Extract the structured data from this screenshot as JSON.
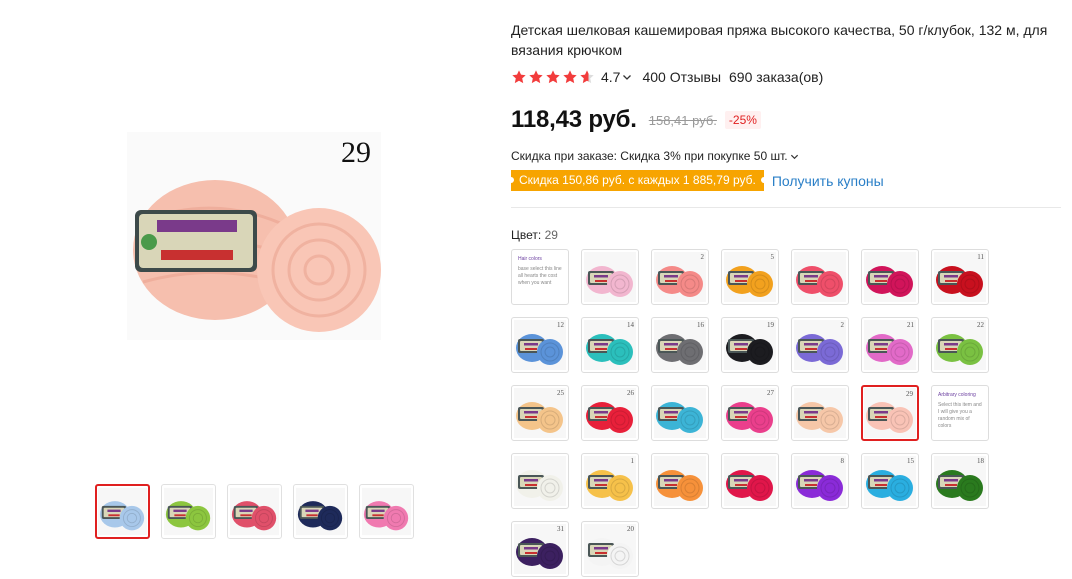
{
  "product": {
    "title": "Детская шелковая кашемировая пряжа высокого качества, 50 г/клубок, 132 м, для вязания крючком",
    "rating": "4.7",
    "reviews": "400 Отзывы",
    "orders": "690 заказа(ов)",
    "price": "118,43 руб.",
    "old_price": "158,41 руб.",
    "discount": "-25%",
    "order_discount": "Скидка при заказе: Скидка 3% при покупке 50 шт.",
    "coupon_badge": "Скидка 150,86 руб. с каждых 1 885,79 руб.",
    "coupon_link": "Получить купоны",
    "color_label": "Цвет:",
    "color_value": "29"
  },
  "gallery": {
    "main_number": "29",
    "thumbnails": [
      {
        "color": "#a8c8ea",
        "alt": "blue-yarn"
      },
      {
        "color": "#8cc63f",
        "alt": "green-yarn"
      },
      {
        "color": "#e0506a",
        "alt": "pink-red-yarn"
      },
      {
        "color": "#1e2a5a",
        "alt": "navy-yarn"
      },
      {
        "color": "#f07ab0",
        "alt": "pink-yarn"
      }
    ]
  },
  "swatches": [
    {
      "type": "text",
      "title": "Hair colors",
      "text": "base select this line all hearts the cost when you want"
    },
    {
      "type": "yarn",
      "color": "#f2b6cf",
      "num": ""
    },
    {
      "type": "yarn",
      "color": "#f58a88",
      "num": "2"
    },
    {
      "type": "yarn",
      "color": "#f2a11e",
      "num": "5"
    },
    {
      "type": "yarn",
      "color": "#ef4f6a",
      "num": ""
    },
    {
      "type": "yarn",
      "color": "#d1145a",
      "num": ""
    },
    {
      "type": "yarn",
      "color": "#c8101e",
      "num": "11"
    },
    {
      "type": "yarn",
      "color": "#5b93d9",
      "num": "12"
    },
    {
      "type": "yarn",
      "color": "#2bbfbc",
      "num": "14"
    },
    {
      "type": "yarn",
      "color": "#6e6e72",
      "num": "16"
    },
    {
      "type": "yarn",
      "color": "#1c1c20",
      "num": "19"
    },
    {
      "type": "yarn",
      "color": "#7b6ad6",
      "num": "2"
    },
    {
      "type": "yarn",
      "color": "#e26ac8",
      "num": "21"
    },
    {
      "type": "yarn",
      "color": "#7ac142",
      "num": "22"
    },
    {
      "type": "yarn",
      "color": "#f4c48a",
      "num": "25"
    },
    {
      "type": "yarn",
      "color": "#e8203a",
      "num": "26"
    },
    {
      "type": "yarn",
      "color": "#3cb4d6",
      "num": ""
    },
    {
      "type": "yarn",
      "color": "#ea3f8c",
      "num": "27"
    },
    {
      "type": "yarn",
      "color": "#f6c7a8",
      "num": ""
    },
    {
      "type": "yarn",
      "color": "#f9c3b6",
      "num": "29",
      "selected": true
    },
    {
      "type": "text",
      "title": "Arbitrary coloring",
      "text": "Select this item and I will give you a random mix of colors"
    },
    {
      "type": "yarn",
      "color": "#f1f1ea",
      "num": ""
    },
    {
      "type": "yarn",
      "color": "#f6c14a",
      "num": "1"
    },
    {
      "type": "yarn",
      "color": "#f6913a",
      "num": ""
    },
    {
      "type": "yarn",
      "color": "#e0164a",
      "num": ""
    },
    {
      "type": "yarn",
      "color": "#8a2bd8",
      "num": "8"
    },
    {
      "type": "yarn",
      "color": "#2aaee0",
      "num": "15"
    },
    {
      "type": "yarn",
      "color": "#2a7a1e",
      "num": "18"
    },
    {
      "type": "yarn",
      "color": "#3c2060",
      "num": "31"
    },
    {
      "type": "yarn",
      "color": "#f4f4f4",
      "num": "20"
    }
  ],
  "colors": {
    "accent_red": "#e02020",
    "star": "#f23c3c",
    "coupon_bg": "#f7a400",
    "link": "#2a7fc7"
  }
}
